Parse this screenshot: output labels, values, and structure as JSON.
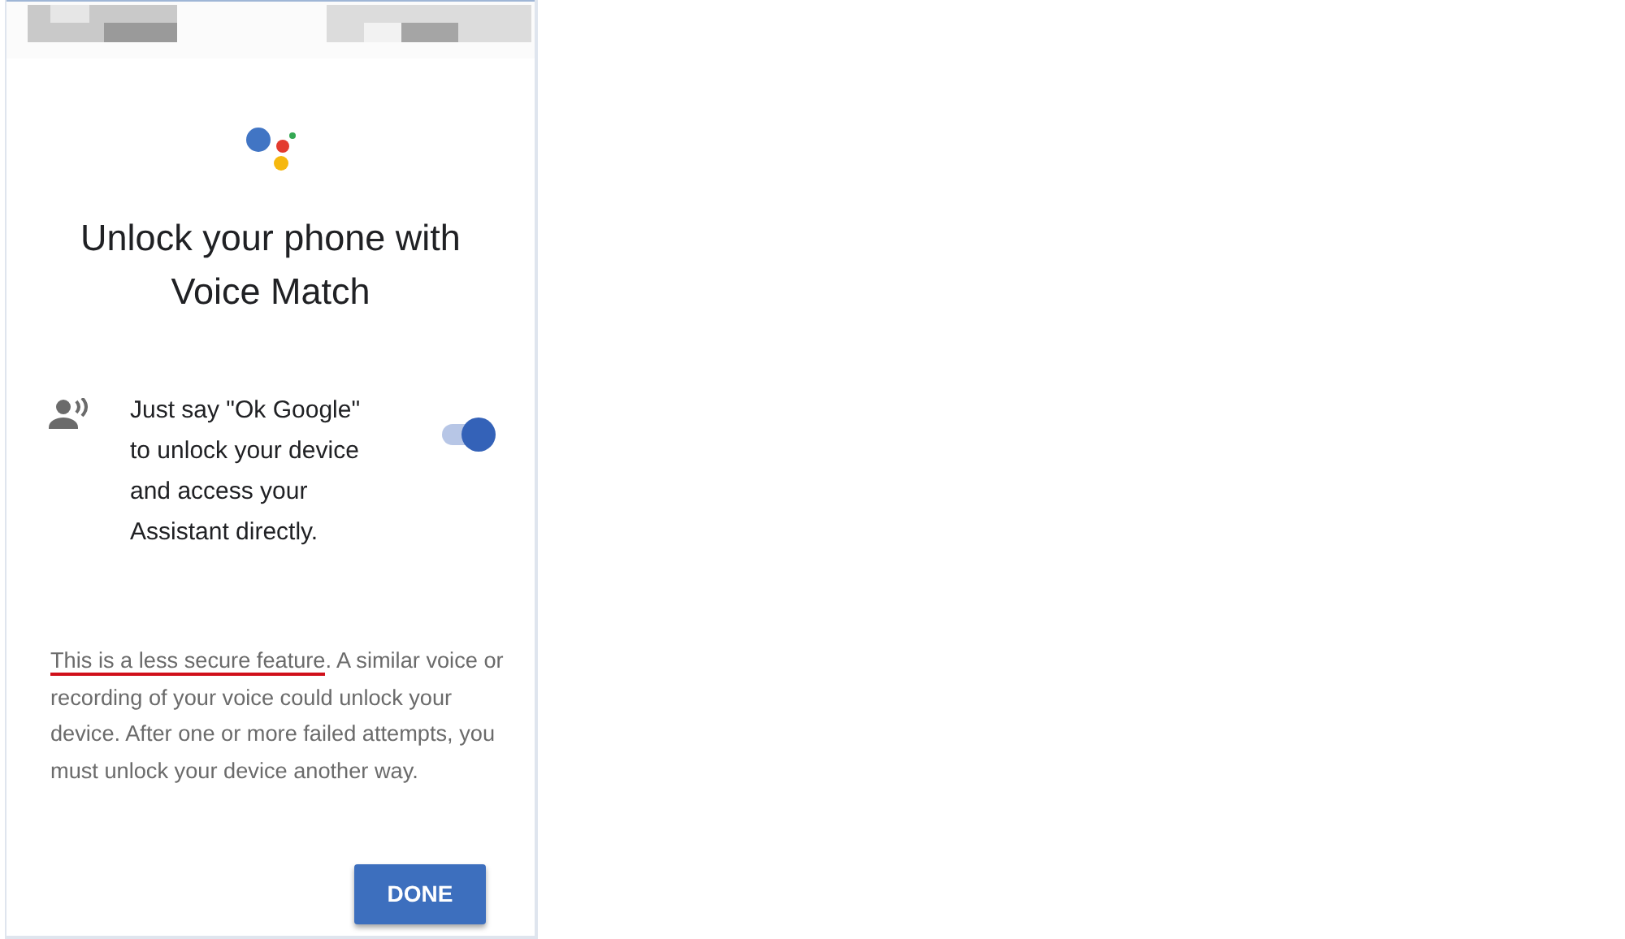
{
  "title": "Unlock your phone with Voice Match",
  "voice_match": {
    "text": "Just say \"Ok Google\" to unlock your device and access your Assistant directly.",
    "on": true
  },
  "notice": {
    "underlined": "This is a less secure feature",
    "rest": ". A similar voice or recording of your voice could unlock your device. After one or more failed attempts, you must unlock your device another way."
  },
  "buttons": [
    {
      "label": "DONE"
    }
  ]
}
